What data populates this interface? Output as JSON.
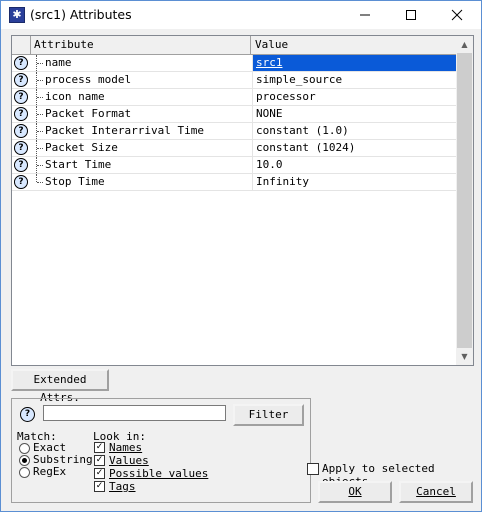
{
  "window": {
    "title": "(src1) Attributes"
  },
  "grid": {
    "headers": {
      "attribute": "Attribute",
      "value": "Value"
    },
    "rows": [
      {
        "name": "name",
        "value": "src1"
      },
      {
        "name": "process model",
        "value": "simple_source"
      },
      {
        "name": "icon name",
        "value": "processor"
      },
      {
        "name": "Packet Format",
        "value": "NONE"
      },
      {
        "name": "Packet Interarrival Time",
        "value": "constant (1.0)"
      },
      {
        "name": "Packet Size",
        "value": "constant (1024)"
      },
      {
        "name": "Start Time",
        "value": "10.0"
      },
      {
        "name": "Stop Time",
        "value": "Infinity"
      }
    ],
    "selected_row": 0,
    "help_glyph": "?"
  },
  "buttons": {
    "extended": "Extended Attrs.",
    "filter": "Filter",
    "ok": "OK",
    "cancel": "Cancel"
  },
  "filter": {
    "input_value": "",
    "match_label": "Match:",
    "match_options": [
      {
        "label": "Exact",
        "selected": false
      },
      {
        "label": "Substring",
        "selected": true
      },
      {
        "label": "RegEx",
        "selected": false
      }
    ],
    "look_in_label": "Look in:",
    "look_in_options": [
      {
        "label": "Names",
        "checked": true
      },
      {
        "label": "Values",
        "checked": true
      },
      {
        "label": "Possible values",
        "checked": true
      },
      {
        "label": "Tags",
        "checked": true
      }
    ]
  },
  "apply": {
    "label": "Apply to selected objects",
    "checked": false
  },
  "colors": {
    "selection": "#0a5ad8",
    "title_border": "#5b8fd3"
  }
}
